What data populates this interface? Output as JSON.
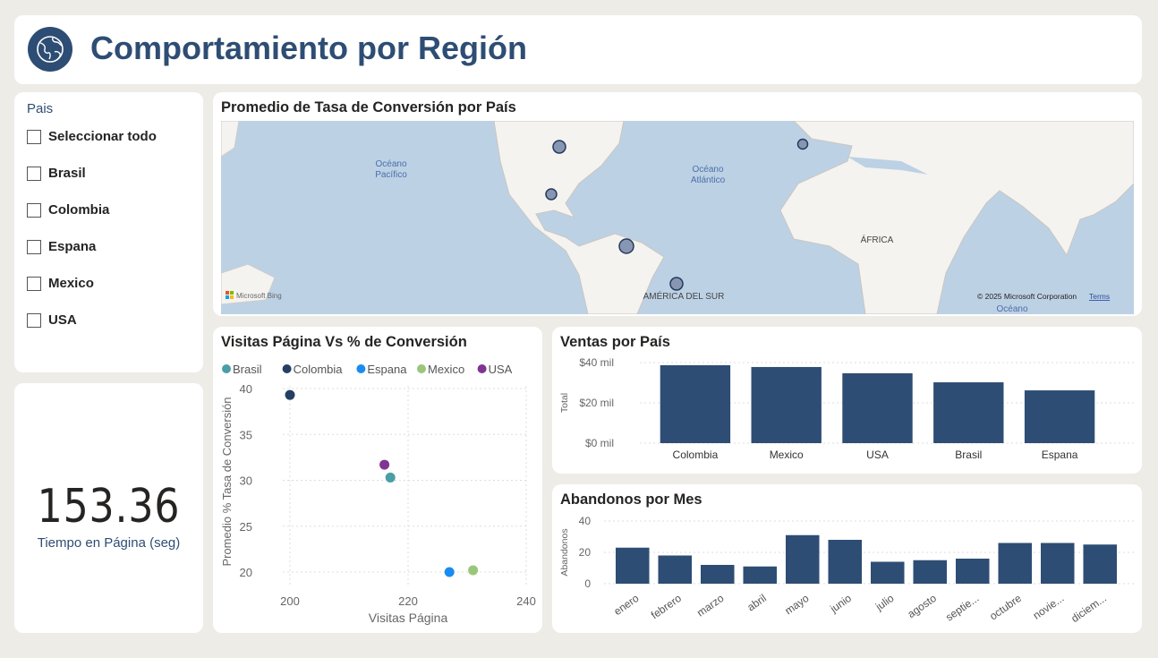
{
  "header": {
    "title": "Comportamiento por Región",
    "icon": "globe-icon"
  },
  "slicer": {
    "label": "Pais",
    "options": [
      "Seleccionar todo",
      "Brasil",
      "Colombia",
      "Espana",
      "Mexico",
      "USA"
    ]
  },
  "kpi": {
    "value": "153.36",
    "label": "Tiempo en Página (seg)"
  },
  "map": {
    "title": "Promedio de Tasa de Conversión por País",
    "labels": {
      "pacific": [
        "Océano",
        "Pacífico"
      ],
      "atlantic": [
        "Océano",
        "Atlántico"
      ],
      "africa": "ÁFRICA",
      "south_america": "AMÉRICA DEL SUR",
      "ocean_bottom": "Océano"
    },
    "attribution": "Microsoft Bing",
    "copyright": "© 2025 Microsoft Corporation",
    "terms": "Terms",
    "countries": [
      "USA",
      "Mexico",
      "Colombia",
      "Brasil",
      "Espana"
    ]
  },
  "chart_data": [
    {
      "type": "scatter",
      "title": "Visitas Página Vs % de Conversión",
      "xlabel": "Visitas Página",
      "ylabel": "Promedio % Tasa de Conversión",
      "xlim": [
        195,
        240
      ],
      "ylim": [
        18,
        40
      ],
      "xticks": [
        200,
        220,
        240
      ],
      "yticks": [
        20,
        25,
        30,
        35,
        40
      ],
      "legend_position": "top-left",
      "series": [
        {
          "name": "Brasil",
          "color": "#4a9ea6",
          "x": 217,
          "y": 30.3
        },
        {
          "name": "Colombia",
          "color": "#253f64",
          "x": 200,
          "y": 39.3
        },
        {
          "name": "Espana",
          "color": "#1a8cf0",
          "x": 227,
          "y": 20
        },
        {
          "name": "Mexico",
          "color": "#9ac67a",
          "x": 231,
          "y": 20.2
        },
        {
          "name": "USA",
          "color": "#7f3591",
          "x": 216,
          "y": 31.7
        }
      ]
    },
    {
      "type": "bar",
      "title": "Ventas por País",
      "ylabel": "Total",
      "categories": [
        "Colombia",
        "Mexico",
        "USA",
        "Brasil",
        "Espana"
      ],
      "values": [
        38.7,
        37.8,
        34.7,
        30.2,
        26.2
      ],
      "unit": "mil $",
      "ylim": [
        0,
        40
      ],
      "yticks": [
        "$0 mil",
        "$20 mil",
        "$40 mil"
      ],
      "color": "#2e4d74"
    },
    {
      "type": "bar",
      "title": "Abandonos por Mes",
      "ylabel": "Abandonos",
      "categories": [
        "enero",
        "febrero",
        "marzo",
        "abril",
        "mayo",
        "junio",
        "julio",
        "agosto",
        "septie...",
        "octubre",
        "novie...",
        "diciem..."
      ],
      "values": [
        23,
        18,
        12,
        11,
        31,
        28,
        14,
        15,
        16,
        26,
        26,
        25
      ],
      "ylim": [
        0,
        40
      ],
      "yticks": [
        "0",
        "20",
        "40"
      ],
      "color": "#2e4d74"
    }
  ]
}
